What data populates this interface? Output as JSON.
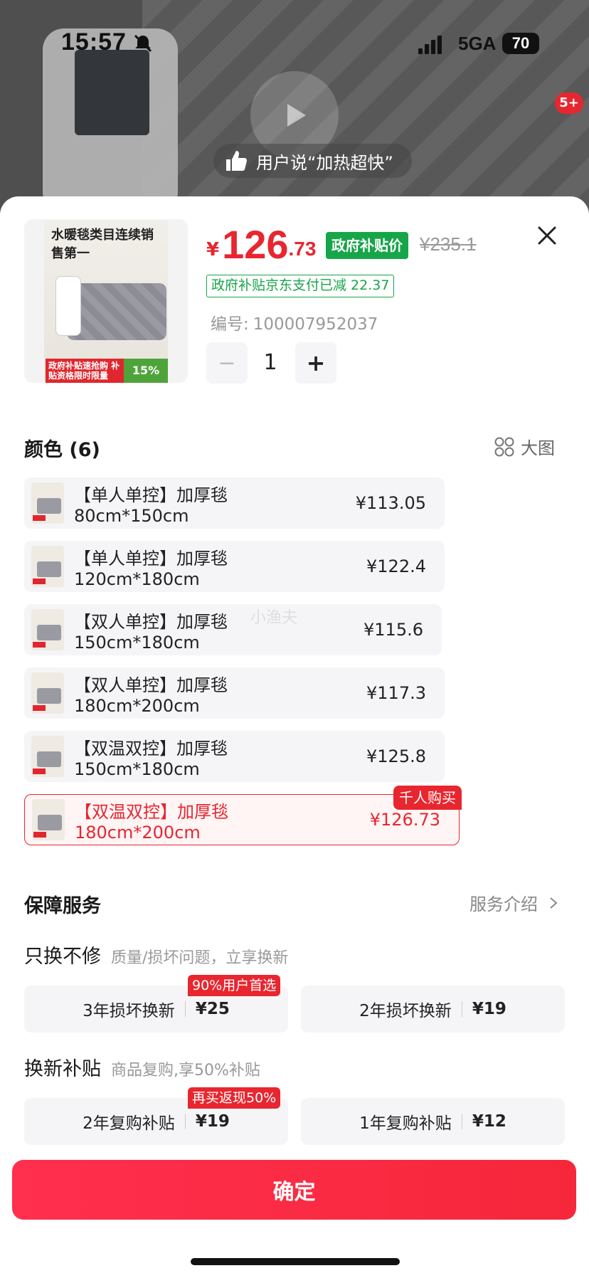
{
  "status_bar": {
    "time": "15:57",
    "network": "5GA",
    "battery": "70"
  },
  "video": {
    "badge_count": "5+",
    "review_text": "用户说“加热超快”"
  },
  "product": {
    "thumb_title": "水暖毯类目连续销售第一",
    "thumb_promo": "政府补贴速抢购 补贴资格限时限量",
    "thumb_discount": "15%",
    "price_symbol": "¥",
    "price_integer": "126",
    "price_decimal": ".73",
    "gov_tag": "政府补贴价",
    "original_price": "¥235.1",
    "subsidy_note": "政府补贴京东支付已减 22.37",
    "sku_label": "编号:",
    "sku_value": "100007952037",
    "quantity": "1",
    "minus_label": "−",
    "plus_label": "+"
  },
  "color_section": {
    "title": "颜色 (6)",
    "big_view_label": "大图",
    "options": [
      {
        "label": "【单人单控】加厚毯 80cm*150cm",
        "price": "¥113.05",
        "selected": false
      },
      {
        "label": "【单人单控】加厚毯 120cm*180cm",
        "price": "¥122.4",
        "selected": false
      },
      {
        "label": "【双人单控】加厚毯 150cm*180cm",
        "price": "¥115.6",
        "selected": false
      },
      {
        "label": "【双人单控】加厚毯 180cm*200cm",
        "price": "¥117.3",
        "selected": false
      },
      {
        "label": "【双温双控】加厚毯 150cm*180cm",
        "price": "¥125.8",
        "selected": false
      },
      {
        "label": "【双温双控】加厚毯 180cm*200cm",
        "price": "¥126.73",
        "selected": true
      }
    ],
    "selected_badge": "千人购买"
  },
  "service_section": {
    "title": "保障服务",
    "intro_label": "服务介绍",
    "groups": [
      {
        "title": "只换不修",
        "desc": "质量/损坏问题，立享换新",
        "options": [
          {
            "label": "3年损坏换新",
            "price": "¥25",
            "badge": "90%用户首选"
          },
          {
            "label": "2年损坏换新",
            "price": "¥19",
            "badge": ""
          }
        ]
      },
      {
        "title": "换新补贴",
        "desc": "商品复购,享50%补贴",
        "options": [
          {
            "label": "2年复购补贴",
            "price": "¥19",
            "badge": "再买返现50%"
          },
          {
            "label": "1年复购补贴",
            "price": "¥12",
            "badge": ""
          }
        ]
      }
    ]
  },
  "confirm_label": "确定",
  "watermark": "小渔夫",
  "colors": {
    "accent_red": "#e8262f",
    "gov_green": "#17a549"
  }
}
